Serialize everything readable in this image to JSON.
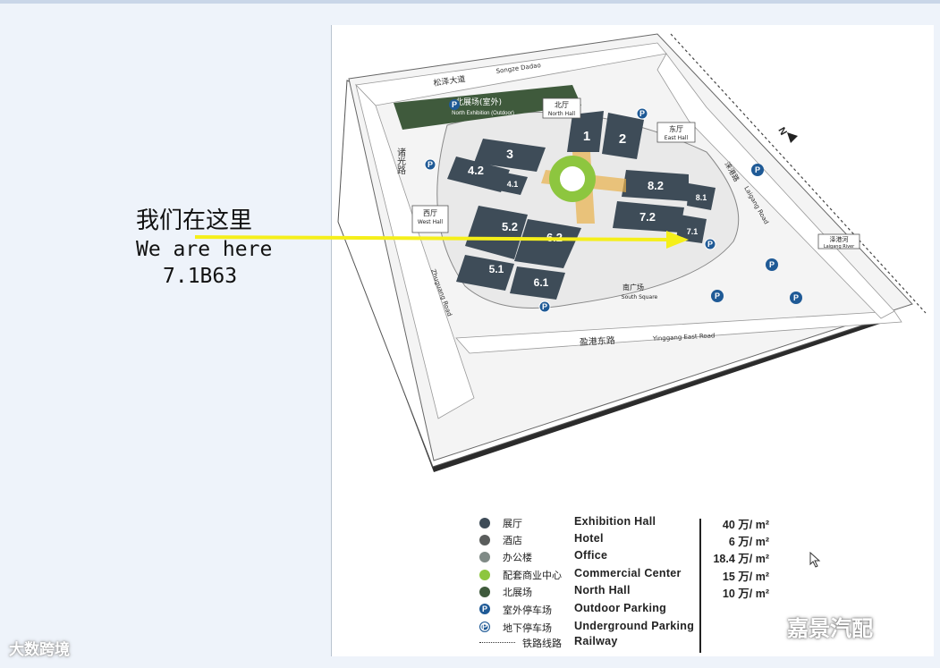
{
  "callout": {
    "zh": "我们在这里",
    "en": "We are here",
    "booth": "7.1B63"
  },
  "map": {
    "roads": {
      "songze_zh": "松泽大道",
      "songze_en": "Songze Dadao",
      "zhuguang_zh": "诸光路",
      "zhuguang_en": "Zhuguang Road",
      "yinggang_zh": "盈港东路",
      "yinggang_en": "Yinggang East Road",
      "laigang_zh": "涞港路",
      "laigang_en": "Laigang Road",
      "river_zh": "泽港河",
      "river_en": "Laigang River"
    },
    "areas": {
      "north_exhibition_zh": "北展场(室外)",
      "north_exhibition_en": "North Exhibition (Outdoor)",
      "north_hall_zh": "北厅",
      "north_hall_en": "North Hall",
      "east_hall_zh": "东厅",
      "east_hall_en": "East Hall",
      "west_hall_zh": "西厅",
      "west_hall_en": "West Hall",
      "south_square_zh": "南广场",
      "south_square_en": "South Square"
    },
    "halls": [
      "1",
      "2",
      "3",
      "4.2",
      "4.1",
      "8.2",
      "8.1",
      "7.2",
      "7.1",
      "5.2",
      "6.2",
      "5.1",
      "6.1"
    ],
    "parking_symbol": "P",
    "compass": "N"
  },
  "legend": {
    "rows": [
      {
        "zh": "展厅",
        "en": "Exhibition Hall",
        "area": "40 万/ m²",
        "color": "#3e4c58",
        "marker": "dot"
      },
      {
        "zh": "酒店",
        "en": "Hotel",
        "area": "6 万/ m²",
        "color": "#5a5d5c",
        "marker": "dot"
      },
      {
        "zh": "办公楼",
        "en": "Office",
        "area": "18.4 万/ m²",
        "color": "#7f8a86",
        "marker": "dot"
      },
      {
        "zh": "配套商业中心",
        "en": "Commercial Center",
        "area": "15 万/ m²",
        "color": "#8dc63f",
        "marker": "dot"
      },
      {
        "zh": "北展场",
        "en": "North Hall",
        "area": "10 万/ m²",
        "color": "#3f5a3c",
        "marker": "dot"
      },
      {
        "zh": "室外停车场",
        "en": "Outdoor Parking",
        "area": "",
        "color": "#1f5a96",
        "marker": "parking"
      },
      {
        "zh": "地下停车场",
        "en": "Underground Parking",
        "area": "",
        "color": "#1f5a96",
        "marker": "parking-ring"
      },
      {
        "zh": "铁路线路",
        "en": "Railway",
        "area": "",
        "color": "#333333",
        "marker": "dash"
      }
    ]
  },
  "watermarks": {
    "left": "大数跨境",
    "right": "嘉景汽配"
  },
  "colors": {
    "arrow": "#f5ef1a",
    "hall_dark": "#3e4c58",
    "ring_green": "#8dc63f",
    "parking": "#1f5a96"
  }
}
